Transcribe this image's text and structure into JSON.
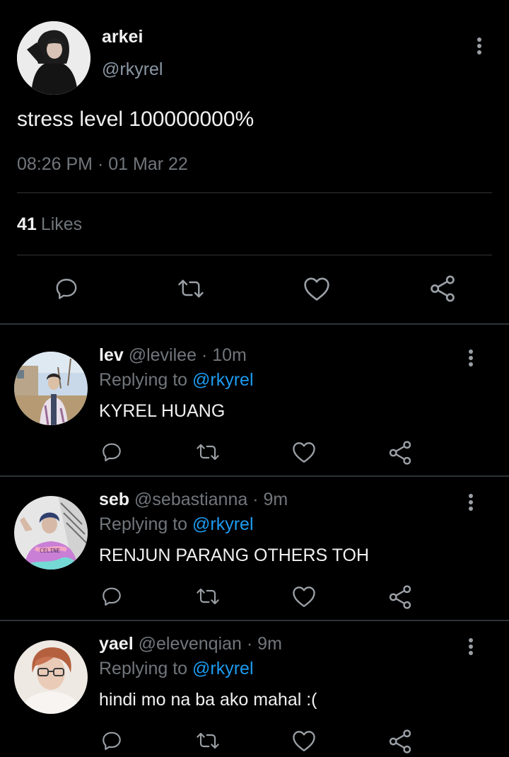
{
  "tweet": {
    "author_name": "arkei",
    "author_handle": "@rkyrel",
    "text": "stress level 100000000%",
    "timestamp": "08:26 PM · 01 Mar 22",
    "likes_count": "41",
    "likes_label": "Likes"
  },
  "icons": {
    "reply": "reply-icon",
    "retweet": "retweet-icon",
    "like": "heart-icon",
    "share": "share-icon",
    "more": "more-vertical-icon"
  },
  "replies": [
    {
      "name": "lev",
      "handle": "@levilee",
      "time": "· 10m",
      "replying_label": "Replying to",
      "replying_to": "@rkyrel",
      "text": "KYREL HUANG"
    },
    {
      "name": "seb",
      "handle": "@sebastianna",
      "time": "· 9m",
      "replying_label": "Replying to",
      "replying_to": "@rkyrel",
      "text": "RENJUN PARANG OTHERS TOH"
    },
    {
      "name": "yael",
      "handle": "@elevenqian",
      "time": "· 9m",
      "replying_label": "Replying to",
      "replying_to": "@rkyrel",
      "text": "hindi mo na ba ako mahal :("
    }
  ],
  "colors": {
    "background": "#000000",
    "text": "#e7e9ea",
    "muted": "#71767b",
    "link": "#1d9bf0",
    "divider": "#2f3336"
  }
}
